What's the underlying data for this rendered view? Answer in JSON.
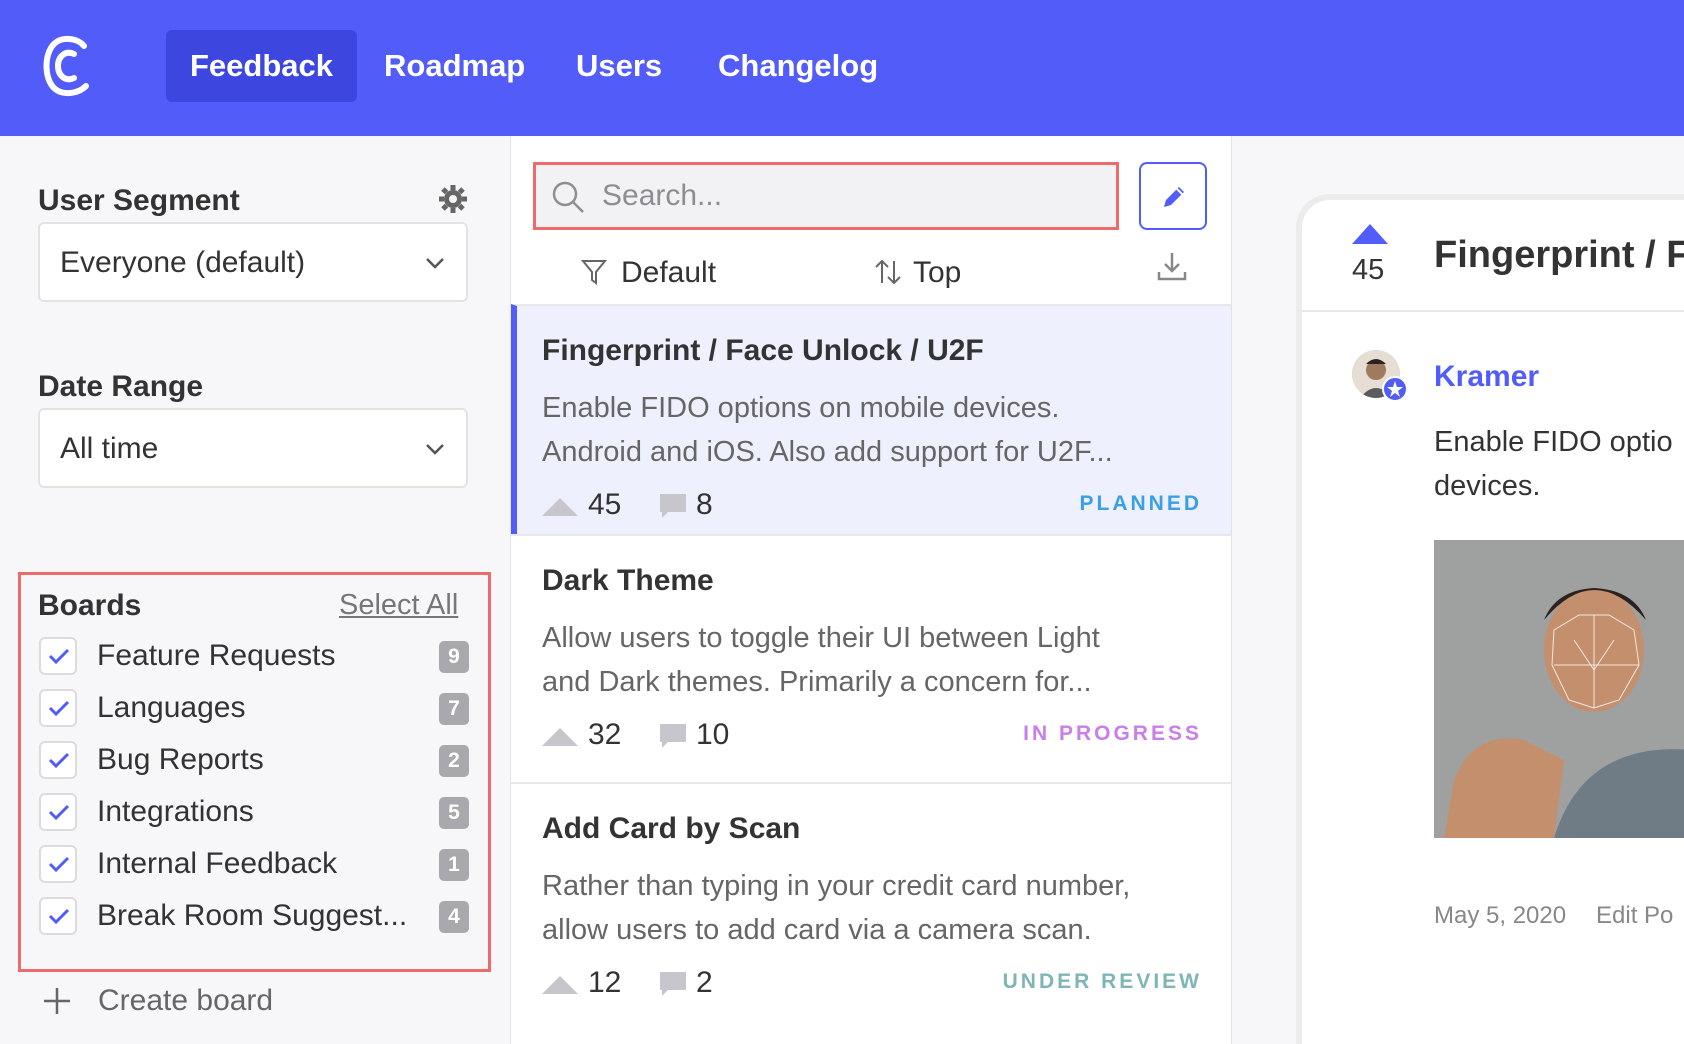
{
  "nav": {
    "items": [
      {
        "label": "Feedback",
        "active": true
      },
      {
        "label": "Roadmap",
        "active": false
      },
      {
        "label": "Users",
        "active": false
      },
      {
        "label": "Changelog",
        "active": false
      }
    ],
    "icons": {
      "logo": "app-logo"
    }
  },
  "sidebar": {
    "segment_title": "User Segment",
    "segment_value": "Everyone (default)",
    "date_title": "Date Range",
    "date_value": "All time",
    "boards_title": "Boards",
    "select_all": "Select All",
    "boards": [
      {
        "label": "Feature Requests",
        "count": "9",
        "checked": true
      },
      {
        "label": "Languages",
        "count": "7",
        "checked": true
      },
      {
        "label": "Bug Reports",
        "count": "2",
        "checked": true
      },
      {
        "label": "Integrations",
        "count": "5",
        "checked": true
      },
      {
        "label": "Internal Feedback",
        "count": "1",
        "checked": true
      },
      {
        "label": "Break Room Suggest...",
        "count": "4",
        "checked": true
      }
    ],
    "create_board": "Create board"
  },
  "list": {
    "search_placeholder": "Search...",
    "filter_label": "Default",
    "sort_label": "Top",
    "posts": [
      {
        "title": "Fingerprint / Face Unlock / U2F",
        "desc_line1": "Enable FIDO options on mobile devices.",
        "desc_line2": "Android and iOS. Also add support for U2F...",
        "votes": "45",
        "comments": "8",
        "status": "PLANNED",
        "status_color": "#3b9fe8"
      },
      {
        "title": "Dark Theme",
        "desc_line1": "Allow users to toggle their UI between Light",
        "desc_line2": "and Dark themes. Primarily a concern for...",
        "votes": "32",
        "comments": "10",
        "status": "IN PROGRESS",
        "status_color": "#c97ee8"
      },
      {
        "title": "Add Card by Scan",
        "desc_line1": "Rather than typing in your credit card number,",
        "desc_line2": "allow users to add card via a camera scan.",
        "votes": "12",
        "comments": "2",
        "status": "UNDER REVIEW",
        "status_color": "#7fb5b5"
      }
    ]
  },
  "detail": {
    "votes": "45",
    "title": "Fingerprint / F",
    "author": "Kramer",
    "body_line1": "Enable FIDO optio",
    "body_line2": "devices.",
    "date": "May 5, 2020",
    "edit": "Edit Po"
  },
  "colors": {
    "brand": "#525df9",
    "highlight": "#ee6b6b"
  }
}
